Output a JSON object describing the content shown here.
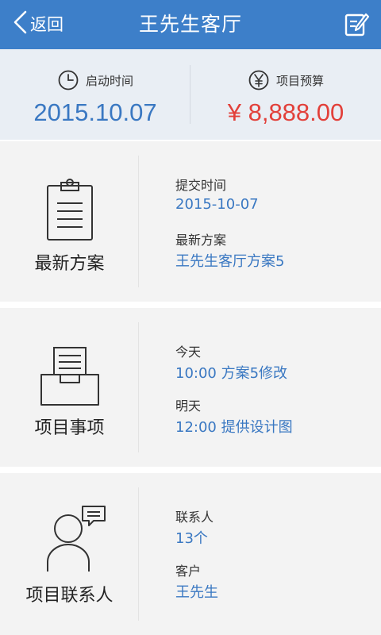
{
  "header": {
    "back_label": "返回",
    "title": "王先生客厅"
  },
  "stats": {
    "start": {
      "label": "启动时间",
      "value": "2015.10.07"
    },
    "budget": {
      "label": "项目预算",
      "value": "¥ 8,888.00"
    }
  },
  "plan": {
    "title": "最新方案",
    "submit_label": "提交时间",
    "submit_value": "2015-10-07",
    "latest_label": "最新方案",
    "latest_value": "王先生客厅方案5"
  },
  "tasks": {
    "title": "项目事项",
    "today_label": "今天",
    "today_value": "10:00  方案5修改",
    "tomorrow_label": "明天",
    "tomorrow_value": "12:00  提供设计图"
  },
  "contacts": {
    "title": "项目联系人",
    "contact_label": "联系人",
    "contact_value": "13个",
    "client_label": "客户",
    "client_value": "王先生"
  },
  "colors": {
    "header": "#3d7fc9",
    "accent_blue": "#3a78c2",
    "price_red": "#e2403a"
  },
  "icons": [
    "back-arrow-icon",
    "edit-icon",
    "clock-icon",
    "yen-icon",
    "clipboard-icon",
    "inbox-tray-icon",
    "person-chat-icon"
  ]
}
